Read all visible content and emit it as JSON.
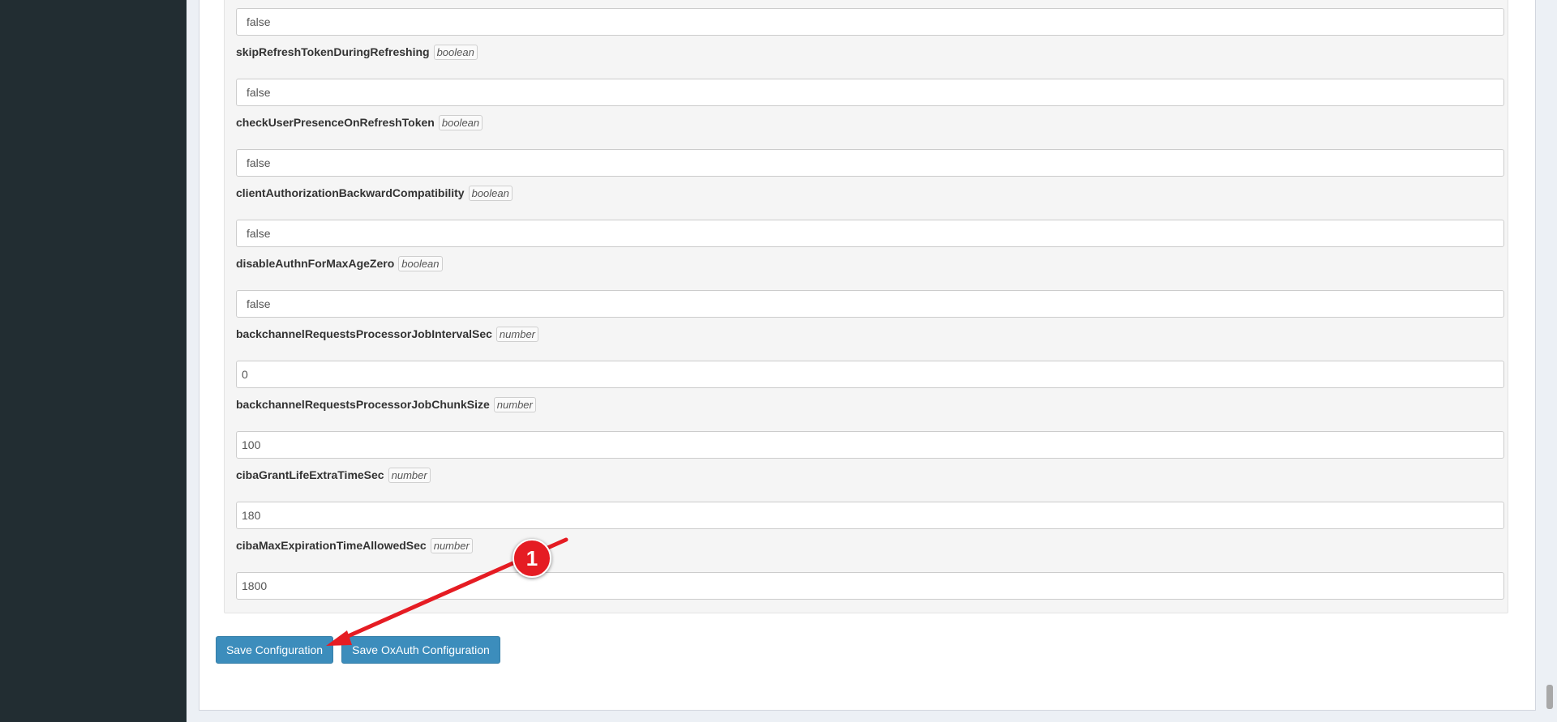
{
  "fields": [
    {
      "name": "",
      "type": "",
      "value": "false",
      "kind": "select"
    },
    {
      "name": "skipRefreshTokenDuringRefreshing",
      "type": "boolean",
      "value": "false",
      "kind": "select"
    },
    {
      "name": "checkUserPresenceOnRefreshToken",
      "type": "boolean",
      "value": "false",
      "kind": "select"
    },
    {
      "name": "clientAuthorizationBackwardCompatibility",
      "type": "boolean",
      "value": "false",
      "kind": "select"
    },
    {
      "name": "disableAuthnForMaxAgeZero",
      "type": "boolean",
      "value": "false",
      "kind": "select"
    },
    {
      "name": "backchannelRequestsProcessorJobIntervalSec",
      "type": "number",
      "value": "0",
      "kind": "text"
    },
    {
      "name": "backchannelRequestsProcessorJobChunkSize",
      "type": "number",
      "value": "100",
      "kind": "text"
    },
    {
      "name": "cibaGrantLifeExtraTimeSec",
      "type": "number",
      "value": "180",
      "kind": "text"
    },
    {
      "name": "cibaMaxExpirationTimeAllowedSec",
      "type": "number",
      "value": "1800",
      "kind": "text"
    }
  ],
  "buttons": {
    "save_config": "Save Configuration",
    "save_oxauth_config": "Save OxAuth Configuration"
  },
  "annotation": {
    "badge": "1",
    "color": "#e51c23"
  },
  "colors": {
    "sidebar": "#222d32",
    "primary_button": "#3c8dbc"
  }
}
